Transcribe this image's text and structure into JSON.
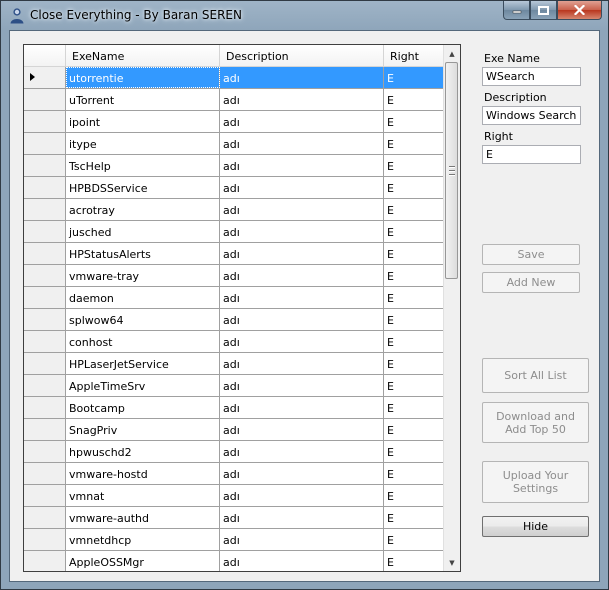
{
  "window": {
    "title": "Close Everything - By Baran SEREN"
  },
  "grid": {
    "columns": [
      "ExeName",
      "Description",
      "Right"
    ],
    "selected_index": 0,
    "rows": [
      {
        "exe": "utorrentie",
        "desc": "adı",
        "right": "E"
      },
      {
        "exe": "uTorrent",
        "desc": "adı",
        "right": "E"
      },
      {
        "exe": "ipoint",
        "desc": "adı",
        "right": "E"
      },
      {
        "exe": "itype",
        "desc": "adı",
        "right": "E"
      },
      {
        "exe": "TscHelp",
        "desc": "adı",
        "right": "E"
      },
      {
        "exe": "HPBDSService",
        "desc": "adı",
        "right": "E"
      },
      {
        "exe": "acrotray",
        "desc": "adı",
        "right": "E"
      },
      {
        "exe": "jusched",
        "desc": "adı",
        "right": "E"
      },
      {
        "exe": "HPStatusAlerts",
        "desc": "adı",
        "right": "E"
      },
      {
        "exe": "vmware-tray",
        "desc": "adı",
        "right": "E"
      },
      {
        "exe": "daemon",
        "desc": "adı",
        "right": "E"
      },
      {
        "exe": "splwow64",
        "desc": "adı",
        "right": "E"
      },
      {
        "exe": "conhost",
        "desc": "adı",
        "right": "E"
      },
      {
        "exe": "HPLaserJetService",
        "desc": "adı",
        "right": "E"
      },
      {
        "exe": "AppleTimeSrv",
        "desc": "adı",
        "right": "E"
      },
      {
        "exe": "Bootcamp",
        "desc": "adı",
        "right": "E"
      },
      {
        "exe": "SnagPriv",
        "desc": "adı",
        "right": "E"
      },
      {
        "exe": "hpwuschd2",
        "desc": "adı",
        "right": "E"
      },
      {
        "exe": "vmware-hostd",
        "desc": "adı",
        "right": "E"
      },
      {
        "exe": "vmnat",
        "desc": "adı",
        "right": "E"
      },
      {
        "exe": "vmware-authd",
        "desc": "adı",
        "right": "E"
      },
      {
        "exe": "vmnetdhcp",
        "desc": "adı",
        "right": "E"
      },
      {
        "exe": "AppleOSSMgr",
        "desc": "adı",
        "right": "E"
      }
    ]
  },
  "form": {
    "exe_name_label": "Exe Name",
    "exe_name_value": "WSearch",
    "description_label": "Description",
    "description_value": "Windows Search",
    "right_label": "Right",
    "right_value": "E"
  },
  "buttons": {
    "save": "Save",
    "add_new": "Add New",
    "sort_all": "Sort All List",
    "download_top": "Download and Add Top 50",
    "upload_settings": "Upload Your Settings",
    "hide": "Hide"
  }
}
